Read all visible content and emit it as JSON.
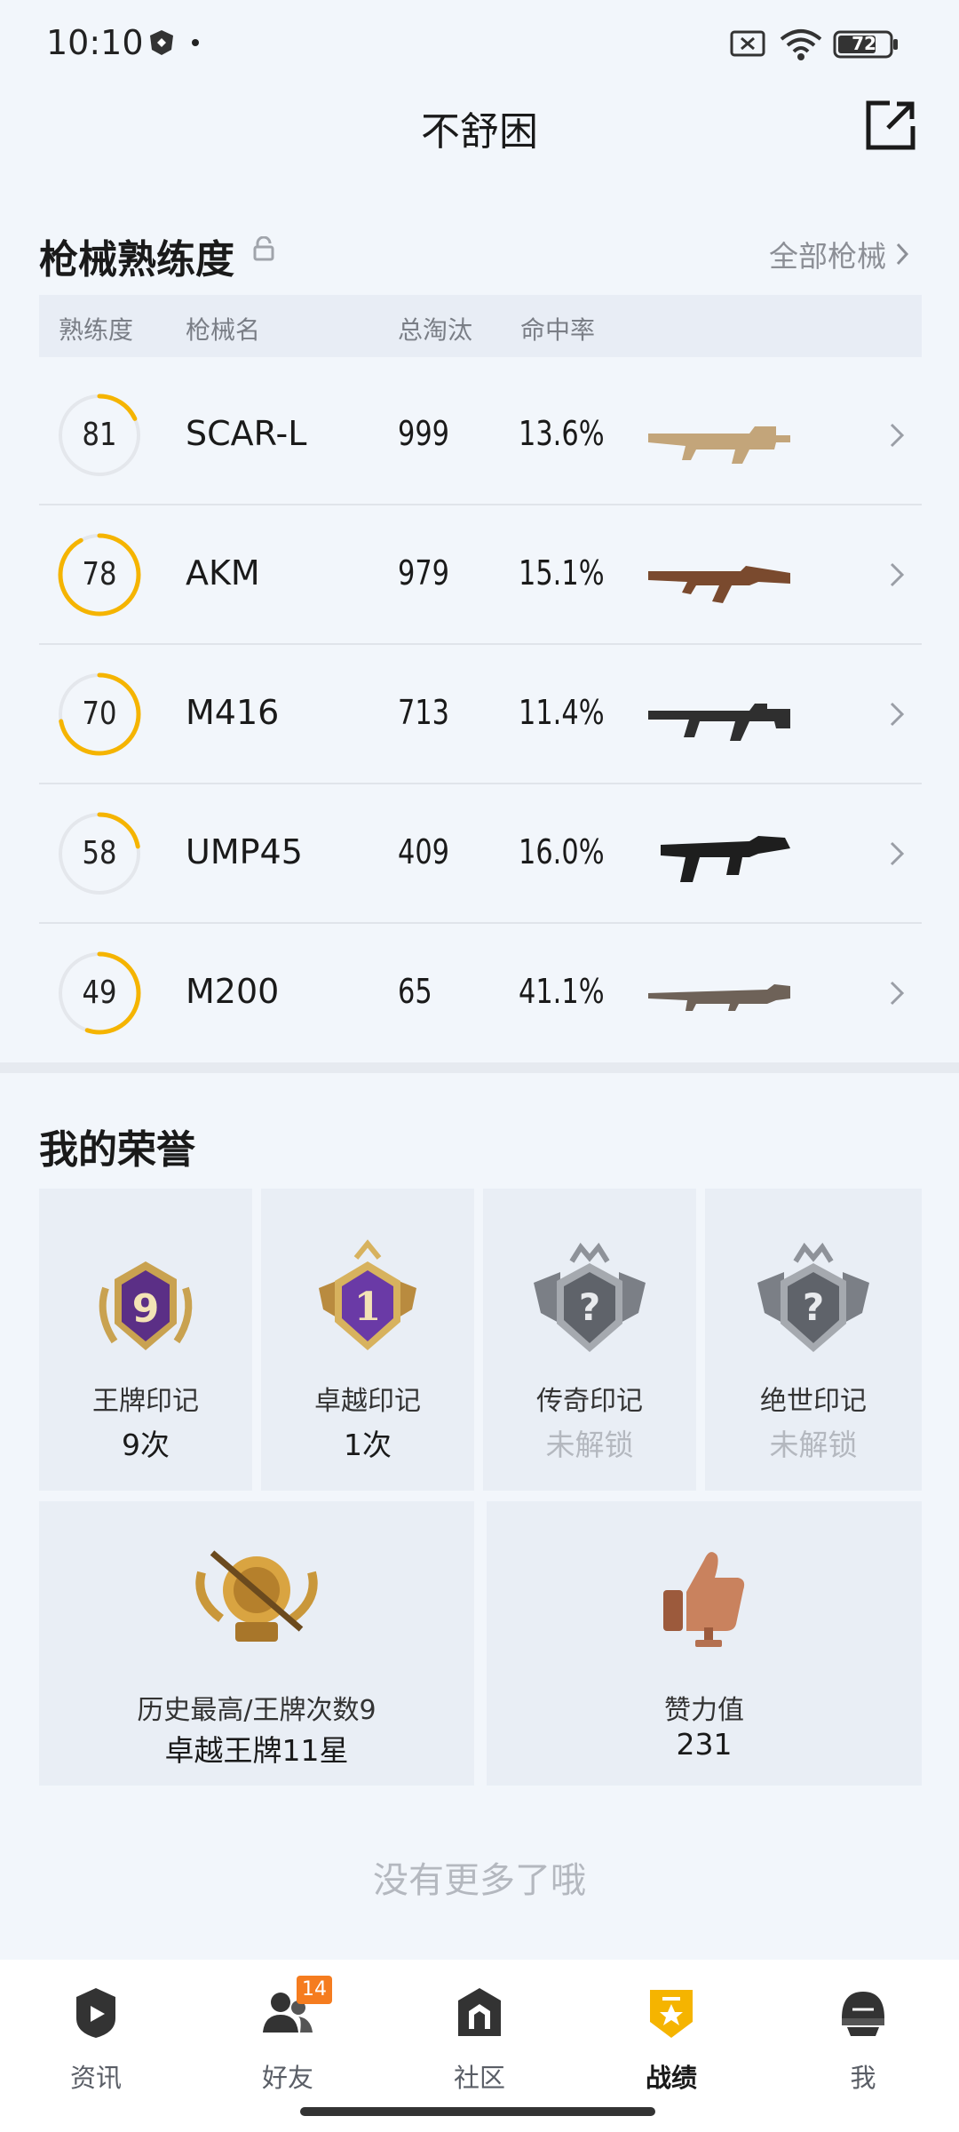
{
  "status_bar": {
    "time": "10:10",
    "battery": "72"
  },
  "header": {
    "title": "不舒困"
  },
  "weapons": {
    "title": "枪械熟练度",
    "all_label": "全部枪械",
    "columns": [
      "熟练度",
      "枪械名",
      "总淘汰",
      "命中率"
    ],
    "rows": [
      {
        "proficiency": "81",
        "name": "SCAR-L",
        "kills": "999",
        "accuracy": "13.6%",
        "progress": 0.18,
        "gun_color": "#c3a57a"
      },
      {
        "proficiency": "78",
        "name": "AKM",
        "kills": "979",
        "accuracy": "15.1%",
        "progress": 0.92,
        "gun_color": "#7a4a2e"
      },
      {
        "proficiency": "70",
        "name": "M416",
        "kills": "713",
        "accuracy": "11.4%",
        "progress": 0.72,
        "gun_color": "#2f2f2f"
      },
      {
        "proficiency": "58",
        "name": "UMP45",
        "kills": "409",
        "accuracy": "16.0%",
        "progress": 0.22,
        "gun_color": "#1e1e1e"
      },
      {
        "proficiency": "49",
        "name": "M200",
        "kills": "65",
        "accuracy": "41.1%",
        "progress": 0.55,
        "gun_color": "#6e6258"
      }
    ]
  },
  "honors": {
    "title": "我的荣誉",
    "cards": [
      {
        "name": "王牌印记",
        "value": "9次",
        "unlocked": true
      },
      {
        "name": "卓越印记",
        "value": "1次",
        "unlocked": true
      },
      {
        "name": "传奇印记",
        "value": "未解锁",
        "unlocked": false
      },
      {
        "name": "绝世印记",
        "value": "未解锁",
        "unlocked": false
      }
    ],
    "wide_cards": [
      {
        "name": "历史最高/王牌次数9",
        "value": "卓越王牌11星"
      },
      {
        "name": "赞力值",
        "value": "231"
      }
    ]
  },
  "footer": {
    "no_more": "没有更多了哦"
  },
  "nav": {
    "items": [
      {
        "label": "资讯",
        "icon": "news-icon"
      },
      {
        "label": "好友",
        "icon": "friends-icon",
        "badge": "14"
      },
      {
        "label": "社区",
        "icon": "community-icon"
      },
      {
        "label": "战绩",
        "icon": "record-icon",
        "active": true
      },
      {
        "label": "我",
        "icon": "profile-icon"
      }
    ]
  },
  "colors": {
    "accent": "#f5b400",
    "ring_track": "#e4e7ec",
    "badge": "#f57c1f"
  }
}
